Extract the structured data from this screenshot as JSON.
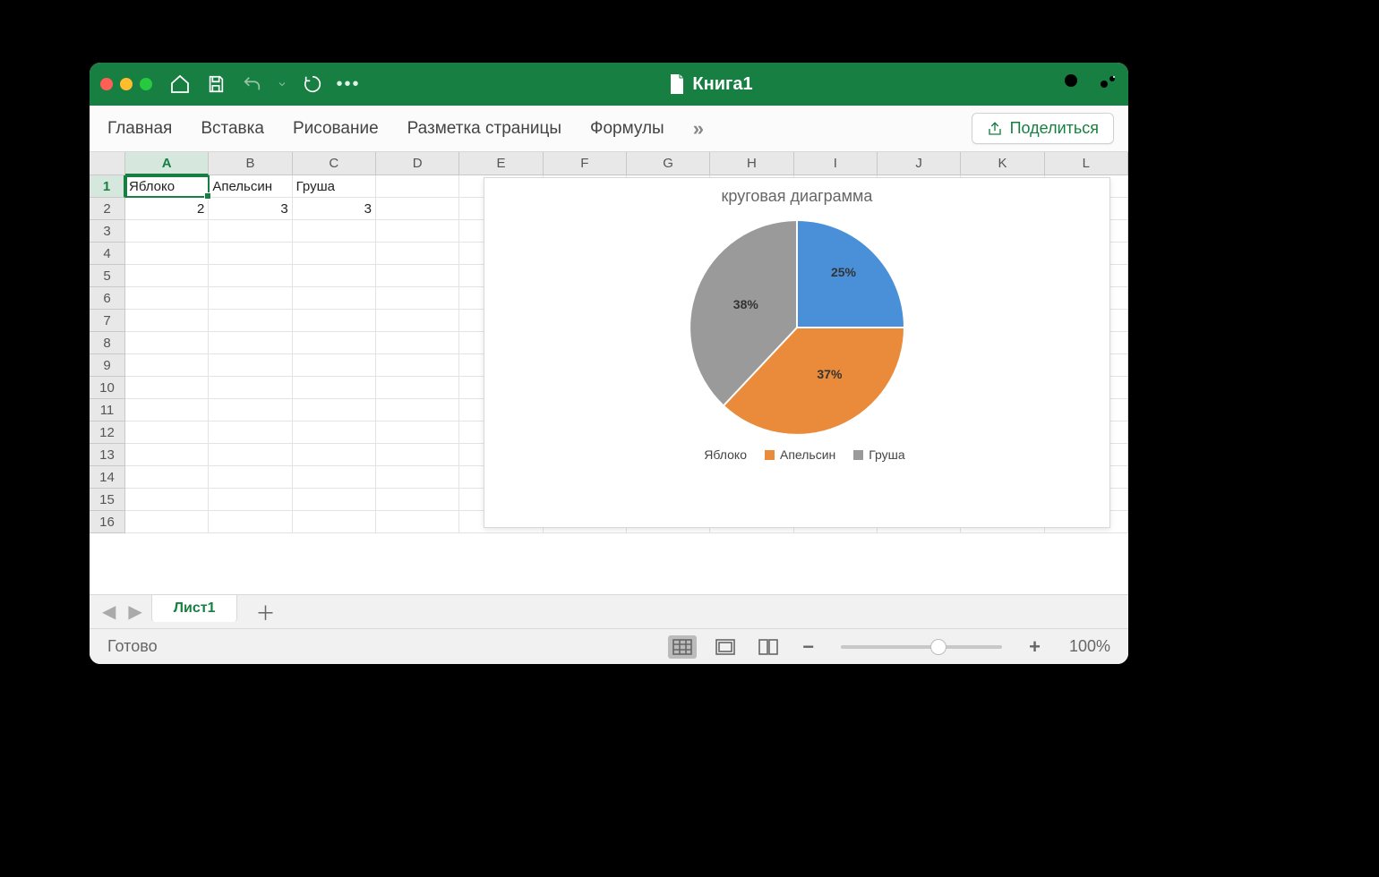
{
  "title": "Книга1",
  "ribbon": {
    "tabs": [
      "Главная",
      "Вставка",
      "Рисование",
      "Разметка страницы",
      "Формулы"
    ],
    "more": "»",
    "share": "Поделиться"
  },
  "columns": [
    "A",
    "B",
    "C",
    "D",
    "E",
    "F",
    "G",
    "H",
    "I",
    "J",
    "K",
    "L"
  ],
  "rows": [
    "1",
    "2",
    "3",
    "4",
    "5",
    "6",
    "7",
    "8",
    "9",
    "10",
    "11",
    "12",
    "13",
    "14",
    "15",
    "16"
  ],
  "sheet": {
    "A1": "Яблоко",
    "B1": "Апельсин",
    "C1": "Груша",
    "A2": "2",
    "B2": "3",
    "C2": "3"
  },
  "active_cell": "A1",
  "chart": {
    "title": "круговая диаграмма",
    "legend": [
      "Яблоко",
      "Апельсин",
      "Груша"
    ],
    "labels": [
      "25%",
      "37%",
      "38%"
    ],
    "colors": {
      "s1": "#4a90d9",
      "s2": "#e98b3a",
      "s3": "#9a9a9a"
    }
  },
  "chart_data": {
    "type": "pie",
    "title": "круговая диаграмма",
    "series": [
      {
        "name": "Яблоко",
        "value": 2,
        "percent": 25
      },
      {
        "name": "Апельсин",
        "value": 3,
        "percent": 37
      },
      {
        "name": "Груша",
        "value": 3,
        "percent": 38
      }
    ]
  },
  "sheet_tabs": {
    "active": "Лист1"
  },
  "status": {
    "ready": "Готово",
    "zoom": "100%"
  }
}
